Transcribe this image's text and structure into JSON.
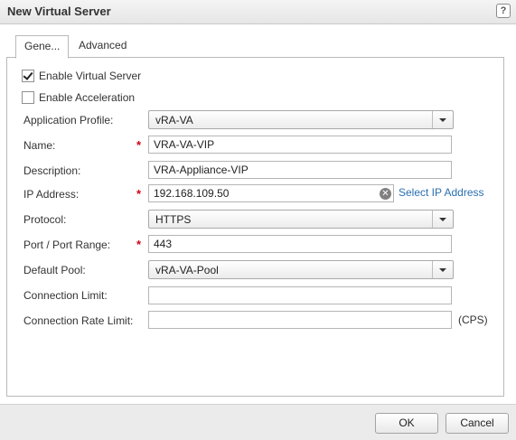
{
  "dialog": {
    "title": "New Virtual Server",
    "help_symbol": "?",
    "tabs": [
      {
        "label": "Gene...",
        "active": true
      },
      {
        "label": "Advanced",
        "active": false
      }
    ],
    "checkboxes": {
      "enable_virtual_server": {
        "label": "Enable Virtual Server",
        "checked": true
      },
      "enable_acceleration": {
        "label": "Enable Acceleration",
        "checked": false
      }
    },
    "fields": {
      "application_profile": {
        "label": "Application Profile:",
        "value": "vRA-VA"
      },
      "name": {
        "label": "Name:",
        "value": "VRA-VA-VIP",
        "required": true
      },
      "description": {
        "label": "Description:",
        "value": "VRA-Appliance-VIP"
      },
      "ip_address": {
        "label": "IP Address:",
        "value": "192.168.109.50",
        "required": true,
        "link_label": "Select IP Address"
      },
      "protocol": {
        "label": "Protocol:",
        "value": "HTTPS"
      },
      "port": {
        "label": "Port / Port Range:",
        "value": "443",
        "required": true
      },
      "default_pool": {
        "label": "Default Pool:",
        "value": "vRA-VA-Pool"
      },
      "connection_limit": {
        "label": "Connection Limit:",
        "value": ""
      },
      "connection_rate_limit": {
        "label": "Connection Rate Limit:",
        "value": "",
        "suffix": "(CPS)"
      }
    },
    "required_marker": "*",
    "buttons": {
      "ok": "OK",
      "cancel": "Cancel"
    },
    "icons": {
      "clear": "clear-icon",
      "help": "help-icon",
      "dropdown": "chevron-down-icon",
      "check": "check-icon"
    },
    "colors": {
      "link": "#2a6fb1",
      "required": "#d0021b"
    }
  }
}
